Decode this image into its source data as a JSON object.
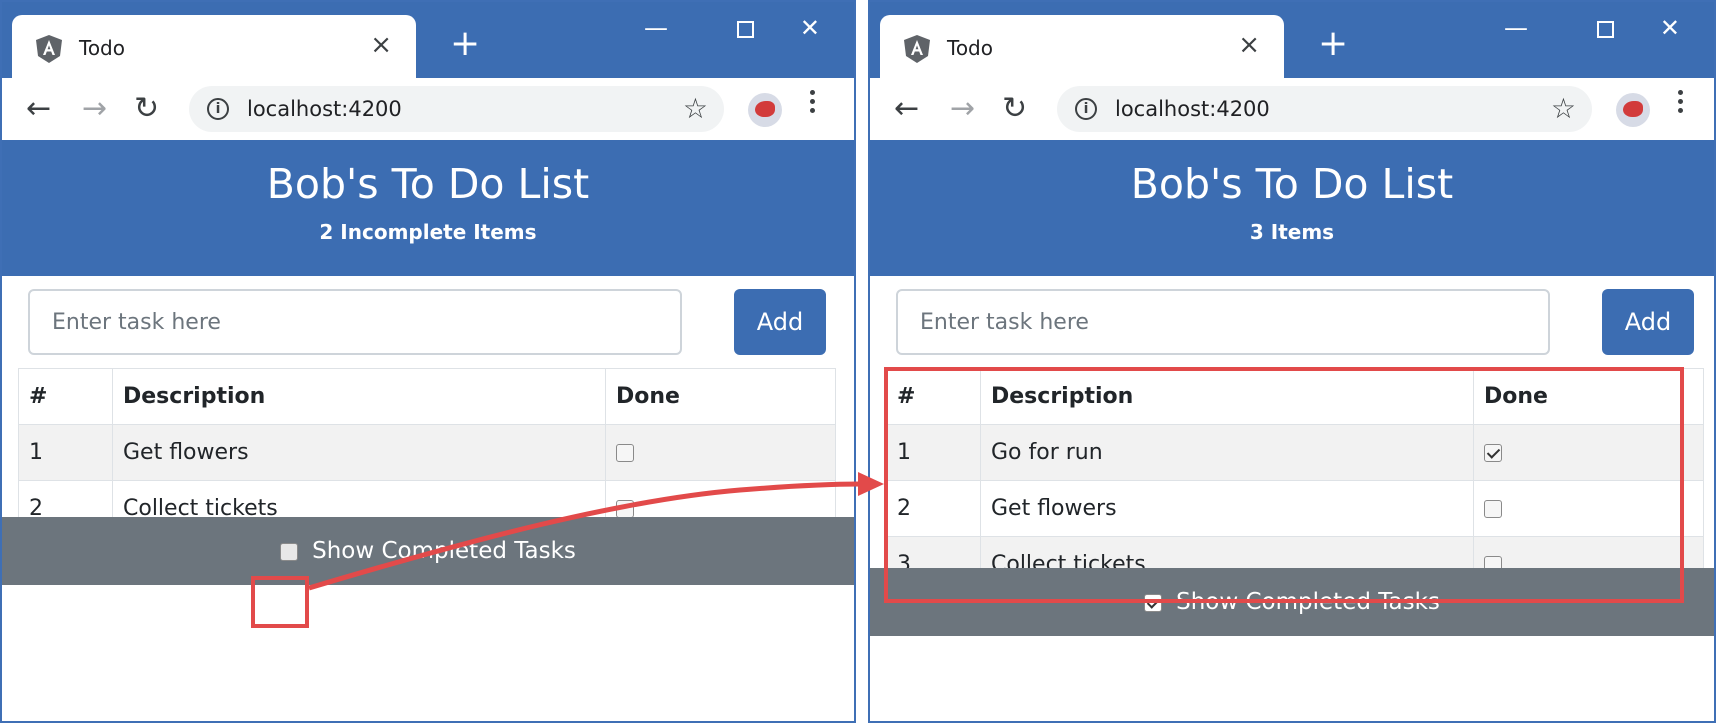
{
  "colors": {
    "accent": "#3c6db2",
    "footer_bg": "#6c757d",
    "highlight": "#e24a4a"
  },
  "browser": {
    "tab_title": "Todo",
    "tab_close": "×",
    "new_tab": "+",
    "url": "localhost:4200",
    "icons": [
      "angular-favicon-icon",
      "back-arrow-icon",
      "forward-arrow-icon",
      "reload-icon",
      "info-icon",
      "star-icon",
      "avatar-icon",
      "menu-icon"
    ]
  },
  "left": {
    "title": "Bob's To Do List",
    "subtitle": "2 Incomplete Items",
    "input_placeholder": "Enter task here",
    "add_label": "Add",
    "columns": [
      "#",
      "Description",
      "Done"
    ],
    "rows": [
      {
        "num": "1",
        "desc": "Get flowers",
        "done": false
      },
      {
        "num": "2",
        "desc": "Collect tickets",
        "done": false
      }
    ],
    "footer_label": "Show Completed Tasks",
    "show_completed": false
  },
  "right": {
    "title": "Bob's To Do List",
    "subtitle": "3 Items",
    "input_placeholder": "Enter task here",
    "add_label": "Add",
    "columns": [
      "#",
      "Description",
      "Done"
    ],
    "rows": [
      {
        "num": "1",
        "desc": "Go for run",
        "done": true
      },
      {
        "num": "2",
        "desc": "Get flowers",
        "done": false
      },
      {
        "num": "3",
        "desc": "Collect tickets",
        "done": false
      }
    ],
    "footer_label": "Show Completed Tasks",
    "show_completed": true
  }
}
